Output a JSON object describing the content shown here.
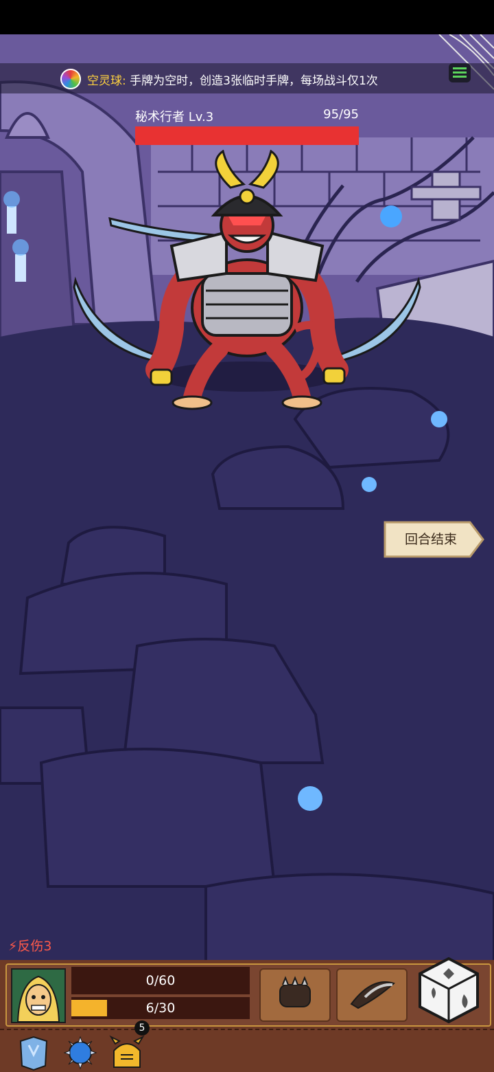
{
  "relic": {
    "name": "空灵球",
    "separator": ":",
    "description": "手牌为空时，创造3张临时手牌，每场战斗仅1次",
    "icon": "rainbow-orb-icon"
  },
  "enemy": {
    "name": "秘术行者",
    "level": "Lv.3",
    "hp_text": "95/95",
    "hp_fraction": 1.0,
    "hp_color": "#e83232",
    "icon": "samurai-demon"
  },
  "end_turn": {
    "label": "回合结束"
  },
  "status_effects": [
    {
      "icon": "thorns-icon",
      "label": "反伤3",
      "color": "#ff5a4a"
    }
  ],
  "player": {
    "portrait_icon": "hero-portrait",
    "hp_text": "0/60",
    "energy_text": "6/30",
    "energy_fraction": 0.2,
    "energy_color": "#f4b32c"
  },
  "skills": [
    {
      "icon": "spiked-fist-icon"
    },
    {
      "icon": "feather-wing-icon"
    }
  ],
  "dice": {
    "icon": "dice-icon"
  },
  "equipment": [
    {
      "icon": "ice-armor-icon"
    },
    {
      "icon": "spiked-orb-icon"
    },
    {
      "icon": "golden-helmet-icon",
      "count": "5"
    }
  ],
  "menu": {
    "icon": "menu-icon"
  }
}
